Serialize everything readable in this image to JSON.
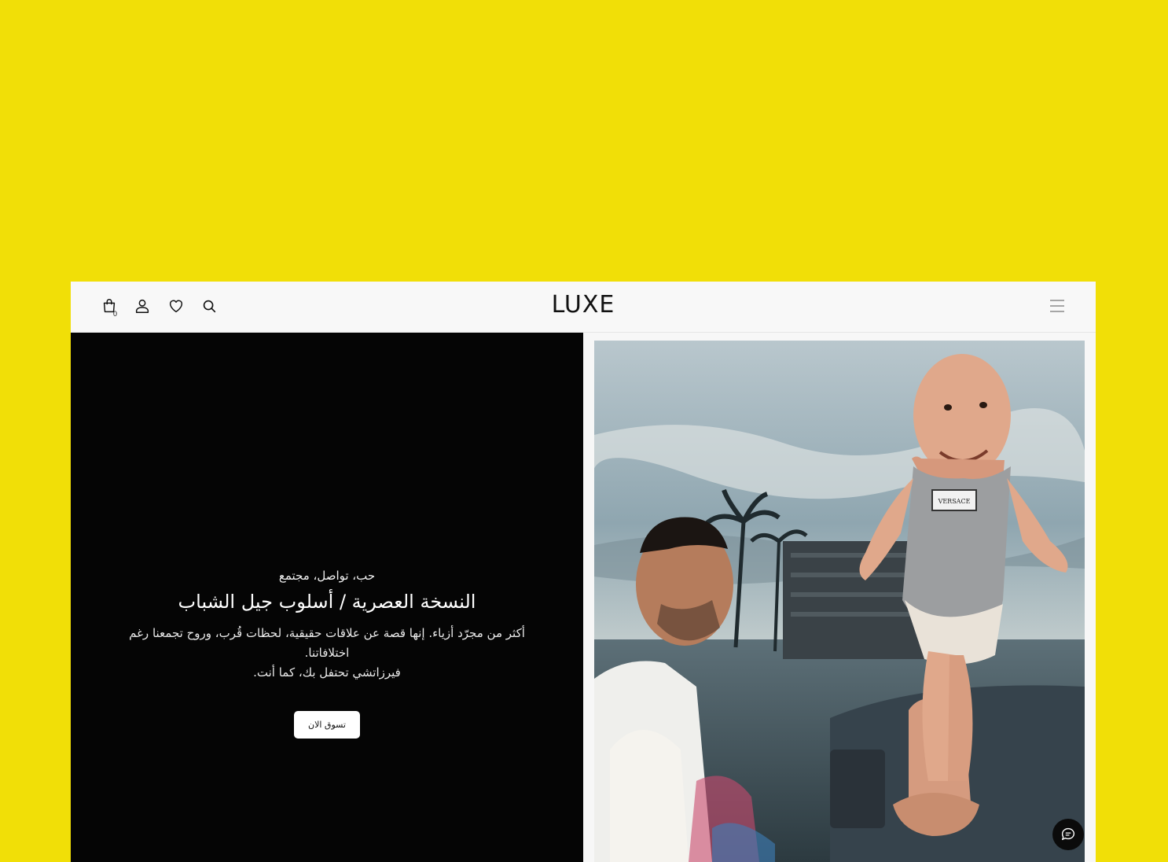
{
  "header": {
    "logo": "LUXE",
    "cart_count": "0",
    "icons": [
      "shopping-bag-icon",
      "user-icon",
      "heart-icon",
      "search-icon",
      "menu-icon"
    ]
  },
  "hero": {
    "kicker": "حب، تواصل، مجتمع",
    "headline": "النسخة العصرية / أسلوب جيل الشباب",
    "body_line1": "أكثر من مجرّد أزياء. إنها قصة عن علاقات حقيقية، لحظات قُرب، وروح تجمعنا رغم اختلافاتنا.",
    "body_line2": "فيرزاتشي تحتفل بك، كما أنت.",
    "cta_label": "تسوق الان",
    "shirt_label": "VERSACE"
  },
  "colors": {
    "backdrop": "#f1df07",
    "hero_panel": "#050505",
    "header_bg": "#f8f8f8"
  },
  "chat": {
    "icon": "chat-icon"
  }
}
